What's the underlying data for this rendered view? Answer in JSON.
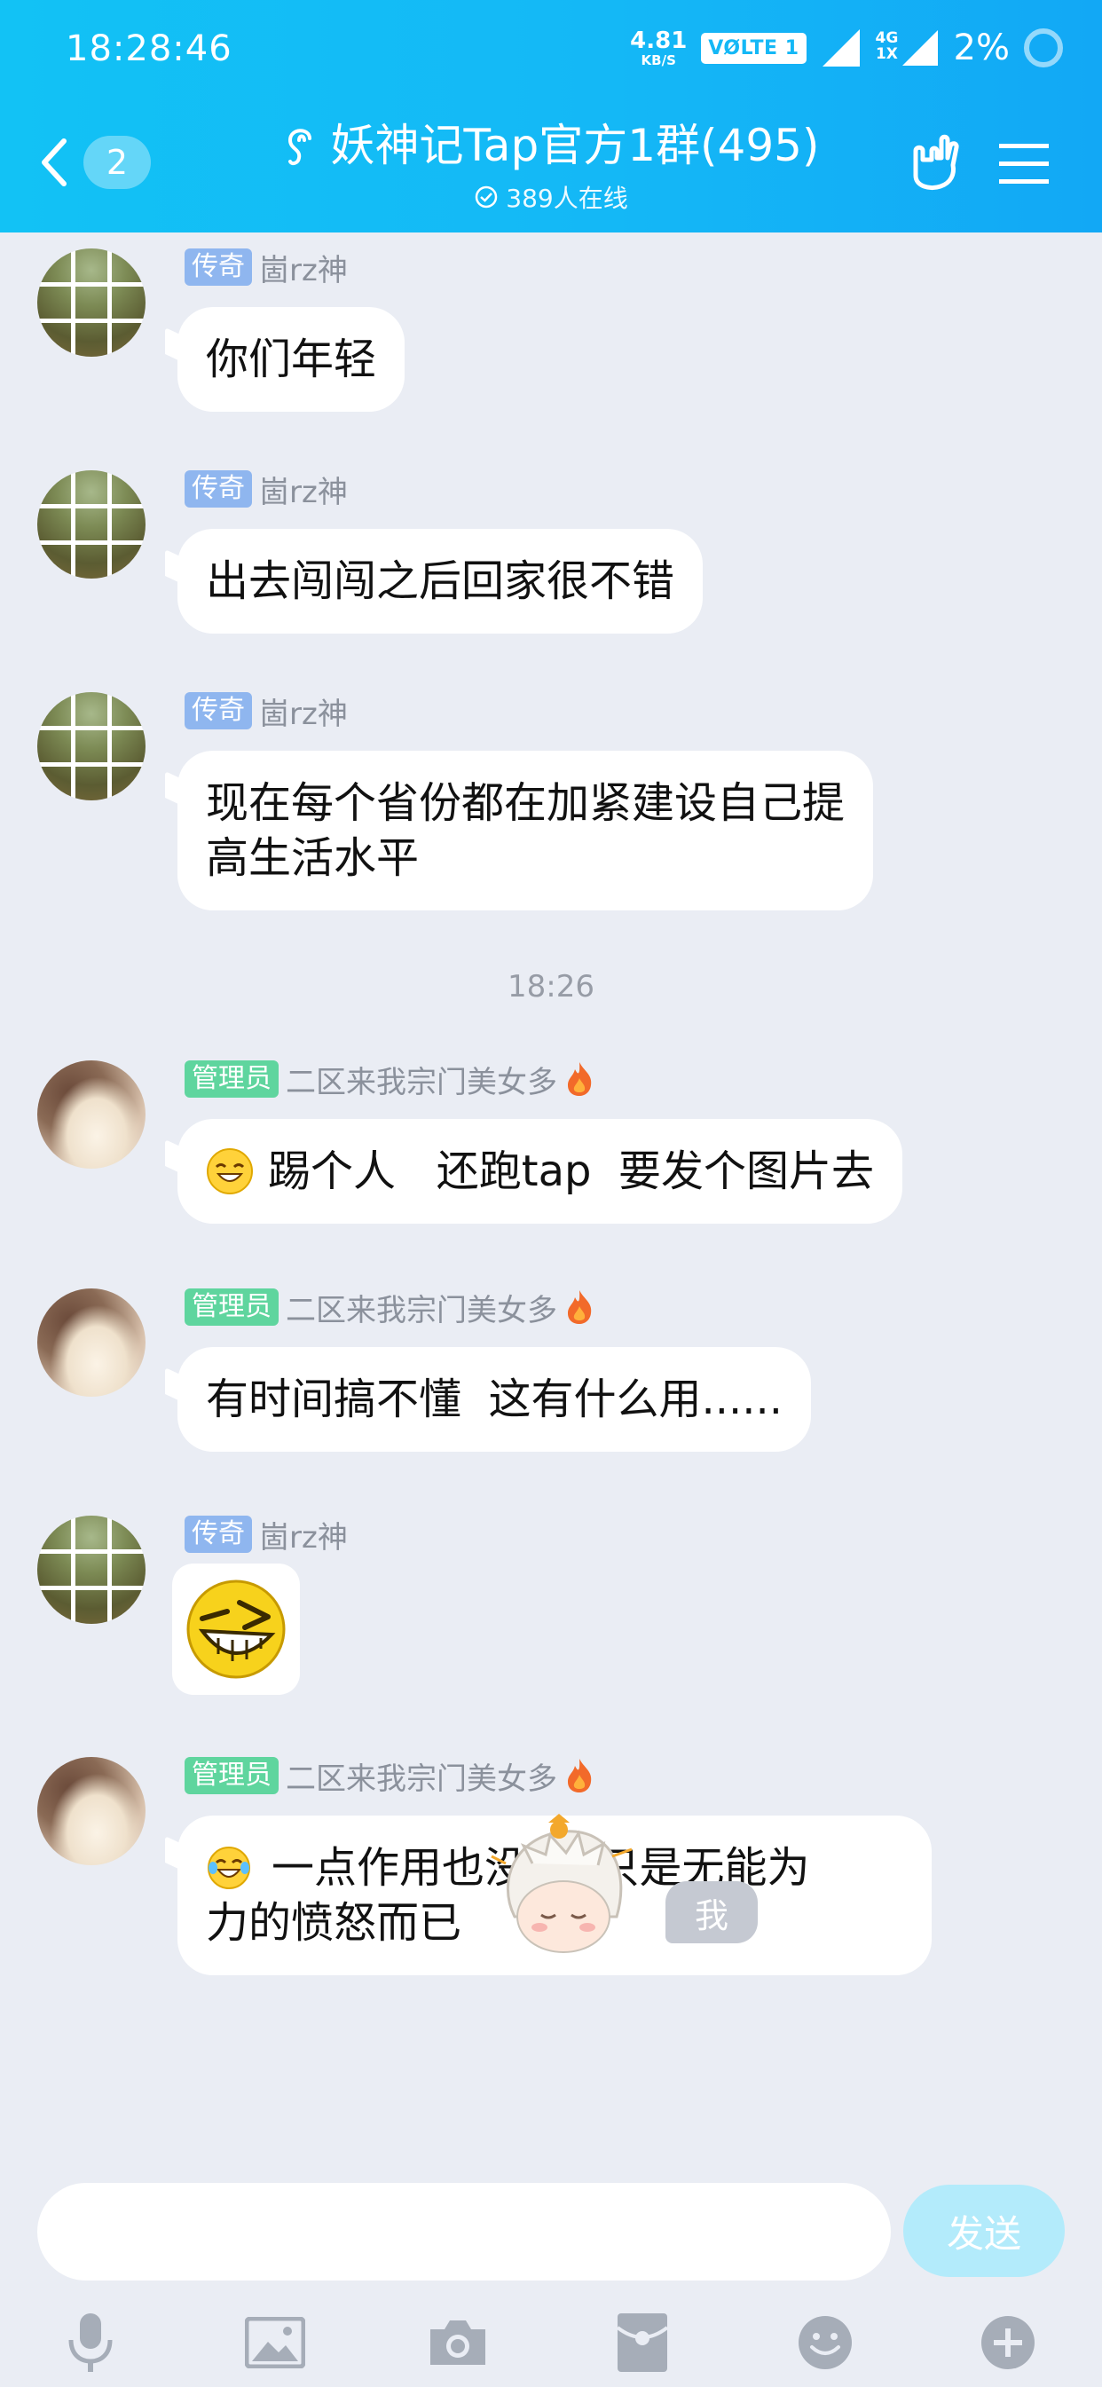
{
  "status_bar": {
    "time": "18:28:46",
    "net_speed": "4.81",
    "net_unit": "KB/S",
    "volte": "VØLTE 1",
    "sig_4g": "4G",
    "sig_1x": "1X",
    "battery": "2%"
  },
  "header": {
    "back_count": "2",
    "title": "妖神记Tap官方1群(495)",
    "online": "389人在线"
  },
  "messages": [
    {
      "badge": "传奇",
      "name": "崮rz神",
      "text": "你们年轻"
    },
    {
      "badge": "传奇",
      "name": "崮rz神",
      "text": "出去闯闯之后回家很不错"
    },
    {
      "badge": "传奇",
      "name": "崮rz神",
      "text_l1": "现在每个省份都在加紧建设自己提",
      "text_l2": "高生活水平"
    },
    {
      "time": "18:26"
    },
    {
      "badge": "管理员",
      "name": "二区来我宗门美女多",
      "text": "踢个人   还跑tap  要发个图片去"
    },
    {
      "badge": "管理员",
      "name": "二区来我宗门美女多",
      "text": "有时间搞不懂  这有什么用......"
    },
    {
      "badge": "传奇",
      "name": "崮rz神",
      "emoji": "laughing-face-sticker"
    },
    {
      "badge": "管理员",
      "name": "二区来我宗门美女多",
      "text_l1": "一点作用也没有, 只是无能为",
      "text_l2": "力的愤怒而已"
    }
  ],
  "self": {
    "label": "我"
  },
  "input": {
    "placeholder": "",
    "send_label": "发送"
  },
  "toolbar": [
    "mic-icon",
    "image-icon",
    "camera-icon",
    "red-packet-icon",
    "emoji-icon",
    "plus-icon"
  ],
  "colors": {
    "header": "#14b8f6",
    "legend_badge": "#8fb6ef",
    "admin_badge": "#5fd59e",
    "send": "#b3ebfb"
  }
}
